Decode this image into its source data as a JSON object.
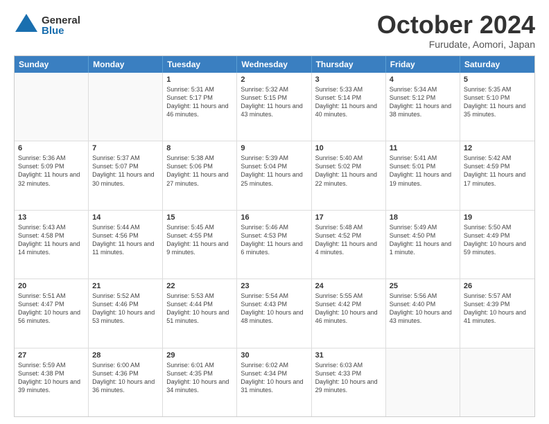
{
  "header": {
    "logo": {
      "line1": "General",
      "line2": "Blue"
    },
    "title": "October 2024",
    "subtitle": "Furudate, Aomori, Japan"
  },
  "days": [
    "Sunday",
    "Monday",
    "Tuesday",
    "Wednesday",
    "Thursday",
    "Friday",
    "Saturday"
  ],
  "rows": [
    [
      {
        "day": "",
        "empty": true
      },
      {
        "day": "",
        "empty": true
      },
      {
        "day": "1",
        "sunrise": "Sunrise: 5:31 AM",
        "sunset": "Sunset: 5:17 PM",
        "daylight": "Daylight: 11 hours and 46 minutes."
      },
      {
        "day": "2",
        "sunrise": "Sunrise: 5:32 AM",
        "sunset": "Sunset: 5:15 PM",
        "daylight": "Daylight: 11 hours and 43 minutes."
      },
      {
        "day": "3",
        "sunrise": "Sunrise: 5:33 AM",
        "sunset": "Sunset: 5:14 PM",
        "daylight": "Daylight: 11 hours and 40 minutes."
      },
      {
        "day": "4",
        "sunrise": "Sunrise: 5:34 AM",
        "sunset": "Sunset: 5:12 PM",
        "daylight": "Daylight: 11 hours and 38 minutes."
      },
      {
        "day": "5",
        "sunrise": "Sunrise: 5:35 AM",
        "sunset": "Sunset: 5:10 PM",
        "daylight": "Daylight: 11 hours and 35 minutes."
      }
    ],
    [
      {
        "day": "6",
        "sunrise": "Sunrise: 5:36 AM",
        "sunset": "Sunset: 5:09 PM",
        "daylight": "Daylight: 11 hours and 32 minutes."
      },
      {
        "day": "7",
        "sunrise": "Sunrise: 5:37 AM",
        "sunset": "Sunset: 5:07 PM",
        "daylight": "Daylight: 11 hours and 30 minutes."
      },
      {
        "day": "8",
        "sunrise": "Sunrise: 5:38 AM",
        "sunset": "Sunset: 5:06 PM",
        "daylight": "Daylight: 11 hours and 27 minutes."
      },
      {
        "day": "9",
        "sunrise": "Sunrise: 5:39 AM",
        "sunset": "Sunset: 5:04 PM",
        "daylight": "Daylight: 11 hours and 25 minutes."
      },
      {
        "day": "10",
        "sunrise": "Sunrise: 5:40 AM",
        "sunset": "Sunset: 5:02 PM",
        "daylight": "Daylight: 11 hours and 22 minutes."
      },
      {
        "day": "11",
        "sunrise": "Sunrise: 5:41 AM",
        "sunset": "Sunset: 5:01 PM",
        "daylight": "Daylight: 11 hours and 19 minutes."
      },
      {
        "day": "12",
        "sunrise": "Sunrise: 5:42 AM",
        "sunset": "Sunset: 4:59 PM",
        "daylight": "Daylight: 11 hours and 17 minutes."
      }
    ],
    [
      {
        "day": "13",
        "sunrise": "Sunrise: 5:43 AM",
        "sunset": "Sunset: 4:58 PM",
        "daylight": "Daylight: 11 hours and 14 minutes."
      },
      {
        "day": "14",
        "sunrise": "Sunrise: 5:44 AM",
        "sunset": "Sunset: 4:56 PM",
        "daylight": "Daylight: 11 hours and 11 minutes."
      },
      {
        "day": "15",
        "sunrise": "Sunrise: 5:45 AM",
        "sunset": "Sunset: 4:55 PM",
        "daylight": "Daylight: 11 hours and 9 minutes."
      },
      {
        "day": "16",
        "sunrise": "Sunrise: 5:46 AM",
        "sunset": "Sunset: 4:53 PM",
        "daylight": "Daylight: 11 hours and 6 minutes."
      },
      {
        "day": "17",
        "sunrise": "Sunrise: 5:48 AM",
        "sunset": "Sunset: 4:52 PM",
        "daylight": "Daylight: 11 hours and 4 minutes."
      },
      {
        "day": "18",
        "sunrise": "Sunrise: 5:49 AM",
        "sunset": "Sunset: 4:50 PM",
        "daylight": "Daylight: 11 hours and 1 minute."
      },
      {
        "day": "19",
        "sunrise": "Sunrise: 5:50 AM",
        "sunset": "Sunset: 4:49 PM",
        "daylight": "Daylight: 10 hours and 59 minutes."
      }
    ],
    [
      {
        "day": "20",
        "sunrise": "Sunrise: 5:51 AM",
        "sunset": "Sunset: 4:47 PM",
        "daylight": "Daylight: 10 hours and 56 minutes."
      },
      {
        "day": "21",
        "sunrise": "Sunrise: 5:52 AM",
        "sunset": "Sunset: 4:46 PM",
        "daylight": "Daylight: 10 hours and 53 minutes."
      },
      {
        "day": "22",
        "sunrise": "Sunrise: 5:53 AM",
        "sunset": "Sunset: 4:44 PM",
        "daylight": "Daylight: 10 hours and 51 minutes."
      },
      {
        "day": "23",
        "sunrise": "Sunrise: 5:54 AM",
        "sunset": "Sunset: 4:43 PM",
        "daylight": "Daylight: 10 hours and 48 minutes."
      },
      {
        "day": "24",
        "sunrise": "Sunrise: 5:55 AM",
        "sunset": "Sunset: 4:42 PM",
        "daylight": "Daylight: 10 hours and 46 minutes."
      },
      {
        "day": "25",
        "sunrise": "Sunrise: 5:56 AM",
        "sunset": "Sunset: 4:40 PM",
        "daylight": "Daylight: 10 hours and 43 minutes."
      },
      {
        "day": "26",
        "sunrise": "Sunrise: 5:57 AM",
        "sunset": "Sunset: 4:39 PM",
        "daylight": "Daylight: 10 hours and 41 minutes."
      }
    ],
    [
      {
        "day": "27",
        "sunrise": "Sunrise: 5:59 AM",
        "sunset": "Sunset: 4:38 PM",
        "daylight": "Daylight: 10 hours and 39 minutes."
      },
      {
        "day": "28",
        "sunrise": "Sunrise: 6:00 AM",
        "sunset": "Sunset: 4:36 PM",
        "daylight": "Daylight: 10 hours and 36 minutes."
      },
      {
        "day": "29",
        "sunrise": "Sunrise: 6:01 AM",
        "sunset": "Sunset: 4:35 PM",
        "daylight": "Daylight: 10 hours and 34 minutes."
      },
      {
        "day": "30",
        "sunrise": "Sunrise: 6:02 AM",
        "sunset": "Sunset: 4:34 PM",
        "daylight": "Daylight: 10 hours and 31 minutes."
      },
      {
        "day": "31",
        "sunrise": "Sunrise: 6:03 AM",
        "sunset": "Sunset: 4:33 PM",
        "daylight": "Daylight: 10 hours and 29 minutes."
      },
      {
        "day": "",
        "empty": true
      },
      {
        "day": "",
        "empty": true
      }
    ]
  ]
}
